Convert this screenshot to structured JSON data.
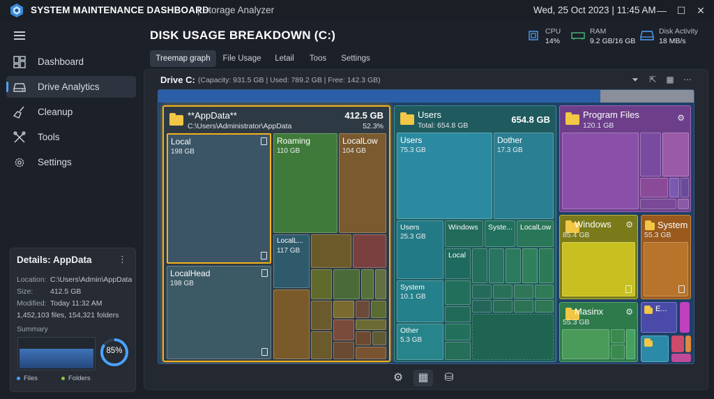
{
  "app": {
    "title": "SYSTEM MAINTENANCE DASHBOARD",
    "subtitle": "| Storage Analyzer",
    "clock": "Wed, 25 Oct 2023 | 11:45 AM"
  },
  "sidebar": {
    "items": [
      {
        "label": "Dashboard",
        "icon": "dashboard-icon"
      },
      {
        "label": "Drive Analytics",
        "icon": "drive-icon",
        "active": true
      },
      {
        "label": "Cleanup",
        "icon": "broom-icon"
      },
      {
        "label": "Tools",
        "icon": "tools-icon"
      },
      {
        "label": "Settings",
        "icon": "gear-icon"
      }
    ]
  },
  "details": {
    "title": "Details: AppData",
    "location_k": "Location:",
    "location_v": "C:\\Users\\Admin\\AppData",
    "size_k": "Size:",
    "size_v": "412.5 GB",
    "modified_k": "Modified:",
    "modified_v": "Today 11:32 AM",
    "counts": "1,452,103 files, 154,321 folders",
    "summary": "Summary",
    "gauge_value": "85%",
    "gauge_fraction": 0.85,
    "legend_files": "Files",
    "legend_folders": "Folders"
  },
  "header": {
    "title": "DISK USAGE BREAKDOWN (C:)",
    "cpu_label": "CPU",
    "cpu_value": "14%",
    "ram_label": "RAM",
    "ram_value": "9.2 GB/16 GB",
    "disk_label": "Disk Activity",
    "disk_value": "18 MB/s"
  },
  "tabs": [
    "Treemap graph",
    "File Usage",
    "Letail",
    "Toos",
    "Settings"
  ],
  "panel": {
    "drive_label": "Drive C:",
    "drive_info": "(Capacity: 931.5 GB | Used: 789.2 GB | Free: 142.3 GB)"
  },
  "treemap": {
    "appdata": {
      "name": "**AppData**",
      "path": "C:\\Users\\Administrator\\AppData",
      "size": "412.5 GB",
      "pct": "52.3%"
    },
    "local": {
      "name": "Local",
      "size": "198 GB"
    },
    "roaming": {
      "name": "Roaming",
      "size": "110 GB"
    },
    "localLow": {
      "name": "LocalLow",
      "size": "104 GB"
    },
    "localL": {
      "name": "LocalL...",
      "size": "117 GB"
    },
    "localHead": {
      "name": "LocalHead",
      "size": "198 GB"
    },
    "users": {
      "name": "Users",
      "sub": "Total: 654.8 GB",
      "size": "654.8 GB"
    },
    "users_a": {
      "name": "Users",
      "size": "75.3 GB"
    },
    "dother": {
      "name": "Dother",
      "size": "17.3 GB"
    },
    "users_b": {
      "name": "Users",
      "size": "25.3 GB"
    },
    "windows_s": {
      "name": "Windows"
    },
    "syste_s": {
      "name": "Syste..."
    },
    "locallow_s": {
      "name": "LocalLow"
    },
    "local_s": {
      "name": "Local"
    },
    "system_s": {
      "name": "System",
      "size": "10.1 GB"
    },
    "other_s": {
      "name": "Other",
      "size": "5.3 GB"
    },
    "programFiles": {
      "name": "Program Files",
      "size": "120.1 GB"
    },
    "windows": {
      "name": "Windows",
      "size": "85.4 GB"
    },
    "system": {
      "name": "System",
      "size": "55.3 GB"
    },
    "masinx": {
      "name": "Masinx",
      "size": "55.3 GB"
    },
    "e_small": {
      "name": "E..."
    }
  },
  "colors": {
    "accent": "#4ea2ff",
    "highlight": "#f5b21c"
  }
}
